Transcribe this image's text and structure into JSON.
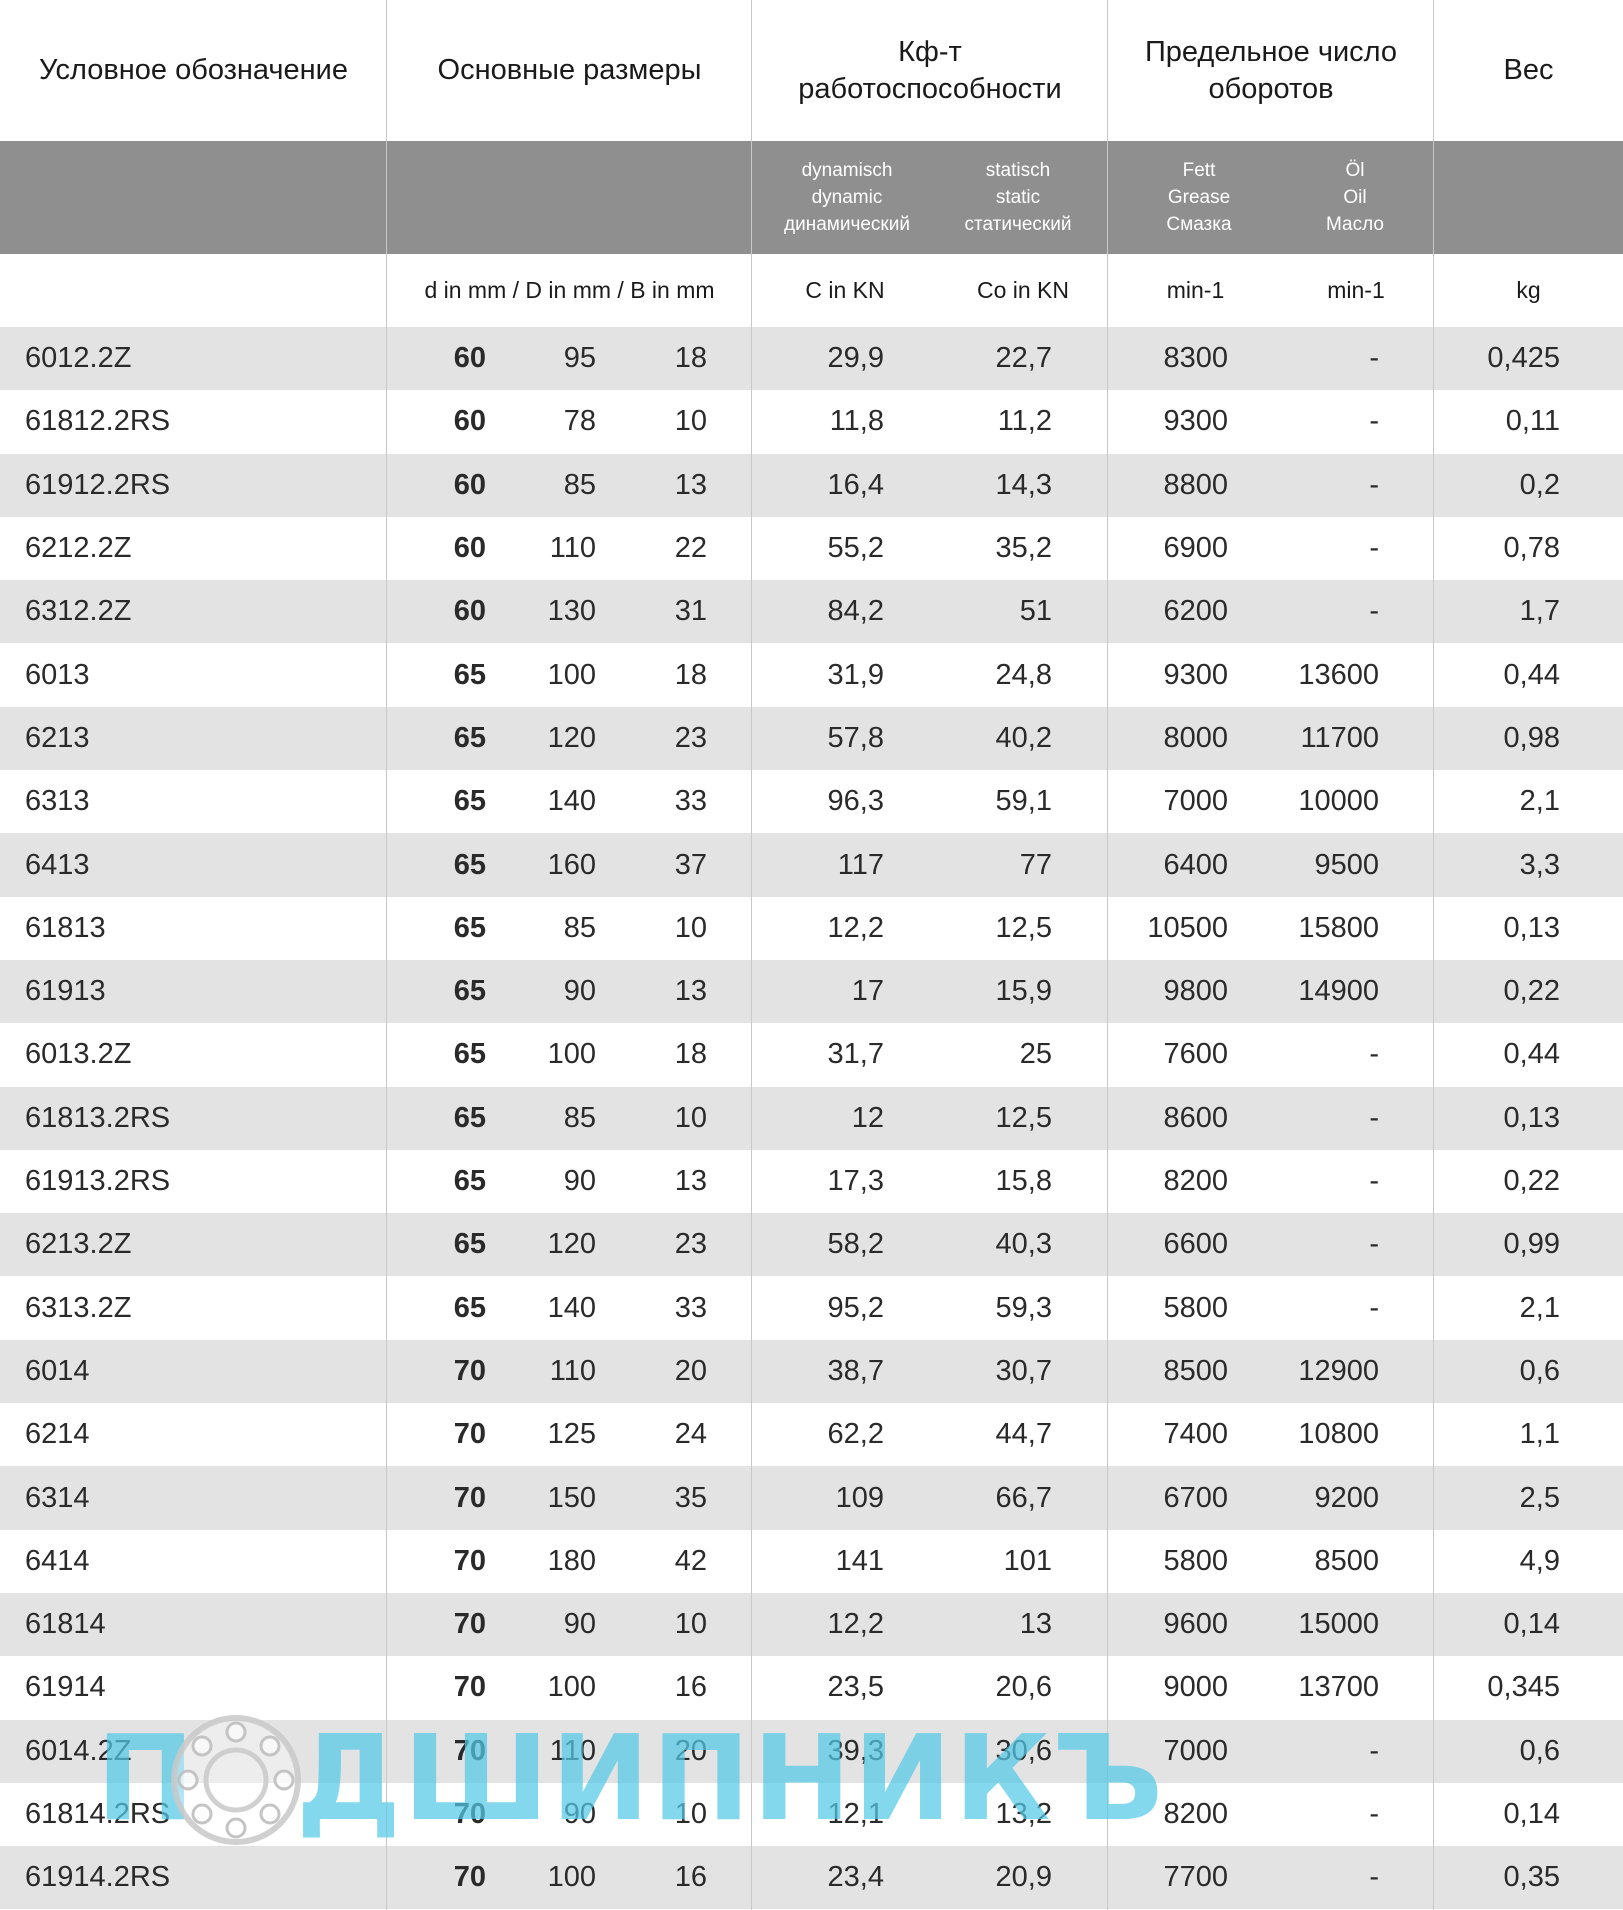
{
  "header": {
    "designation": "Условное обозначение",
    "dimensions": "Основные размеры",
    "capacity": "Кф-т работоспособности",
    "speed": "Предельное число оборотов",
    "weight": "Вес",
    "dynamic": "dynamisch\ndynamic\nдинамический",
    "static": "statisch\nstatic\nстатический",
    "grease": "Fett\nGrease\nСмазка",
    "oil": "Öl\nOil\nМасло",
    "units_dims": "d in mm / D in mm / B in mm",
    "units_c": "C in KN",
    "units_co": "Co in KN",
    "units_grease": "min-1",
    "units_oil": "min-1",
    "units_weight": "kg"
  },
  "rows": [
    [
      "6012.2Z",
      "60",
      "95",
      "18",
      "29,9",
      "22,7",
      "8300",
      "-",
      "0,425"
    ],
    [
      "61812.2RS",
      "60",
      "78",
      "10",
      "11,8",
      "11,2",
      "9300",
      "-",
      "0,11"
    ],
    [
      "61912.2RS",
      "60",
      "85",
      "13",
      "16,4",
      "14,3",
      "8800",
      "-",
      "0,2"
    ],
    [
      "6212.2Z",
      "60",
      "110",
      "22",
      "55,2",
      "35,2",
      "6900",
      "-",
      "0,78"
    ],
    [
      "6312.2Z",
      "60",
      "130",
      "31",
      "84,2",
      "51",
      "6200",
      "-",
      "1,7"
    ],
    [
      "6013",
      "65",
      "100",
      "18",
      "31,9",
      "24,8",
      "9300",
      "13600",
      "0,44"
    ],
    [
      "6213",
      "65",
      "120",
      "23",
      "57,8",
      "40,2",
      "8000",
      "11700",
      "0,98"
    ],
    [
      "6313",
      "65",
      "140",
      "33",
      "96,3",
      "59,1",
      "7000",
      "10000",
      "2,1"
    ],
    [
      "6413",
      "65",
      "160",
      "37",
      "117",
      "77",
      "6400",
      "9500",
      "3,3"
    ],
    [
      "61813",
      "65",
      "85",
      "10",
      "12,2",
      "12,5",
      "10500",
      "15800",
      "0,13"
    ],
    [
      "61913",
      "65",
      "90",
      "13",
      "17",
      "15,9",
      "9800",
      "14900",
      "0,22"
    ],
    [
      "6013.2Z",
      "65",
      "100",
      "18",
      "31,7",
      "25",
      "7600",
      "-",
      "0,44"
    ],
    [
      "61813.2RS",
      "65",
      "85",
      "10",
      "12",
      "12,5",
      "8600",
      "-",
      "0,13"
    ],
    [
      "61913.2RS",
      "65",
      "90",
      "13",
      "17,3",
      "15,8",
      "8200",
      "-",
      "0,22"
    ],
    [
      "6213.2Z",
      "65",
      "120",
      "23",
      "58,2",
      "40,3",
      "6600",
      "-",
      "0,99"
    ],
    [
      "6313.2Z",
      "65",
      "140",
      "33",
      "95,2",
      "59,3",
      "5800",
      "-",
      "2,1"
    ],
    [
      "6014",
      "70",
      "110",
      "20",
      "38,7",
      "30,7",
      "8500",
      "12900",
      "0,6"
    ],
    [
      "6214",
      "70",
      "125",
      "24",
      "62,2",
      "44,7",
      "7400",
      "10800",
      "1,1"
    ],
    [
      "6314",
      "70",
      "150",
      "35",
      "109",
      "66,7",
      "6700",
      "9200",
      "2,5"
    ],
    [
      "6414",
      "70",
      "180",
      "42",
      "141",
      "101",
      "5800",
      "8500",
      "4,9"
    ],
    [
      "61814",
      "70",
      "90",
      "10",
      "12,2",
      "13",
      "9600",
      "15000",
      "0,14"
    ],
    [
      "61914",
      "70",
      "100",
      "16",
      "23,5",
      "20,6",
      "9000",
      "13700",
      "0,345"
    ],
    [
      "6014.2Z",
      "70",
      "110",
      "20",
      "39,3",
      "30,6",
      "7000",
      "-",
      "0,6"
    ],
    [
      "61814.2RS",
      "70",
      "90",
      "10",
      "12,1",
      "13,2",
      "8200",
      "-",
      "0,14"
    ],
    [
      "61914.2RS",
      "70",
      "100",
      "16",
      "23,4",
      "20,9",
      "7700",
      "-",
      "0,35"
    ]
  ],
  "watermark": {
    "first_letter": "П",
    "rest": "ДШИПНИКЪ",
    "logo": "bearing-ring-logo"
  },
  "colors": {
    "band": "#8f8f8f",
    "stripe": "#e3e3e3",
    "watermark": "#54c9e8"
  }
}
